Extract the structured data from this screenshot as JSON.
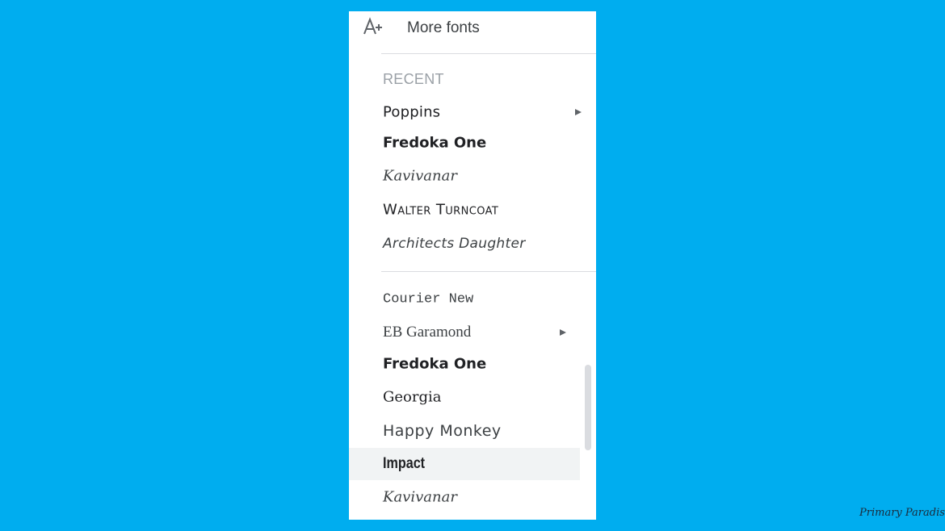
{
  "menu": {
    "more_fonts_label": "More fonts",
    "more_fonts_icon": "font-add-icon",
    "recent_header": "RECENT",
    "recent_items": [
      {
        "label": "Poppins",
        "has_submenu": true
      },
      {
        "label": "Fredoka One",
        "has_submenu": false
      },
      {
        "label": "Kavivanar",
        "has_submenu": false
      },
      {
        "label": "Walter Turncoat",
        "has_submenu": false
      },
      {
        "label": "Architects Daughter",
        "has_submenu": false
      }
    ],
    "all_items": [
      {
        "label": "Courier New",
        "has_submenu": false
      },
      {
        "label": "EB Garamond",
        "has_submenu": true
      },
      {
        "label": "Fredoka One",
        "has_submenu": false
      },
      {
        "label": "Georgia",
        "has_submenu": false
      },
      {
        "label": "Happy Monkey",
        "has_submenu": false
      },
      {
        "label": "Impact",
        "has_submenu": false,
        "selected": true
      },
      {
        "label": "Kavivanar",
        "has_submenu": false
      }
    ]
  },
  "watermark": "Primary Paradise",
  "colors": {
    "background": "#00adef",
    "menu_bg": "#ffffff",
    "selected_bg": "#f1f3f4",
    "header_text": "#9aa0a6"
  }
}
